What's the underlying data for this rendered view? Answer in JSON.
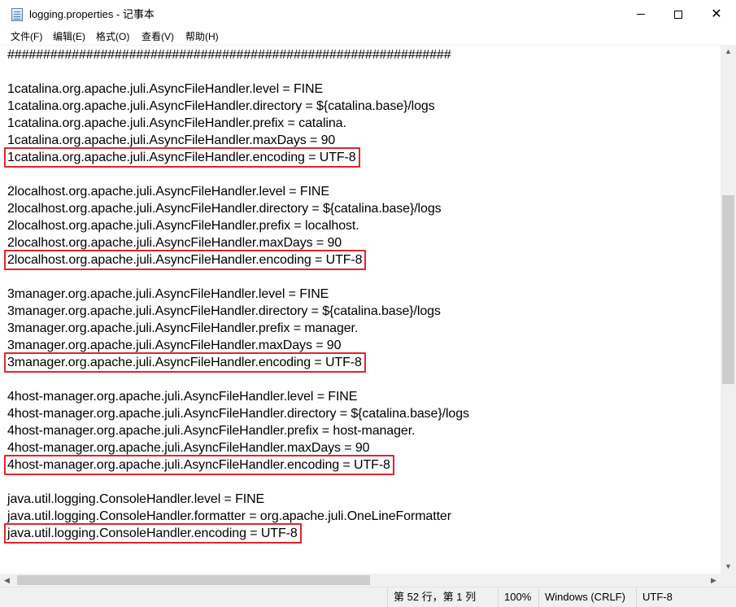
{
  "window": {
    "title": "logging.properties - 记事本",
    "controls": {
      "minimize": "minimize-icon",
      "maximize": "maximize-icon",
      "close": "close-icon"
    }
  },
  "menu": {
    "file": "文件(F)",
    "edit": "编辑(E)",
    "format": "格式(O)",
    "view": "查看(V)",
    "help": "帮助(H)"
  },
  "editor": {
    "lines": [
      "##############################################################",
      "",
      "1catalina.org.apache.juli.AsyncFileHandler.level = FINE",
      "1catalina.org.apache.juli.AsyncFileHandler.directory = ${catalina.base}/logs",
      "1catalina.org.apache.juli.AsyncFileHandler.prefix = catalina.",
      "1catalina.org.apache.juli.AsyncFileHandler.maxDays = 90",
      "1catalina.org.apache.juli.AsyncFileHandler.encoding = UTF-8",
      "",
      "2localhost.org.apache.juli.AsyncFileHandler.level = FINE",
      "2localhost.org.apache.juli.AsyncFileHandler.directory = ${catalina.base}/logs",
      "2localhost.org.apache.juli.AsyncFileHandler.prefix = localhost.",
      "2localhost.org.apache.juli.AsyncFileHandler.maxDays = 90",
      "2localhost.org.apache.juli.AsyncFileHandler.encoding = UTF-8",
      "",
      "3manager.org.apache.juli.AsyncFileHandler.level = FINE",
      "3manager.org.apache.juli.AsyncFileHandler.directory = ${catalina.base}/logs",
      "3manager.org.apache.juli.AsyncFileHandler.prefix = manager.",
      "3manager.org.apache.juli.AsyncFileHandler.maxDays = 90",
      "3manager.org.apache.juli.AsyncFileHandler.encoding = UTF-8",
      "",
      "4host-manager.org.apache.juli.AsyncFileHandler.level = FINE",
      "4host-manager.org.apache.juli.AsyncFileHandler.directory = ${catalina.base}/logs",
      "4host-manager.org.apache.juli.AsyncFileHandler.prefix = host-manager.",
      "4host-manager.org.apache.juli.AsyncFileHandler.maxDays = 90",
      "4host-manager.org.apache.juli.AsyncFileHandler.encoding = UTF-8",
      "",
      "java.util.logging.ConsoleHandler.level = FINE",
      "java.util.logging.ConsoleHandler.formatter = org.apache.juli.OneLineFormatter",
      "java.util.logging.ConsoleHandler.encoding = UTF-8"
    ],
    "highlighted_lines": [
      6,
      12,
      18,
      24,
      28
    ],
    "highlight_color": "#e0252a"
  },
  "scrollbars": {
    "up_icon": "scroll-up-arrow-icon",
    "down_icon": "scroll-down-arrow-icon",
    "left_icon": "scroll-left-arrow-icon",
    "right_icon": "scroll-right-arrow-icon"
  },
  "status": {
    "position": "第 52 行，第 1 列",
    "zoom": "100%",
    "line_ending": "Windows (CRLF)",
    "encoding": "UTF-8"
  }
}
